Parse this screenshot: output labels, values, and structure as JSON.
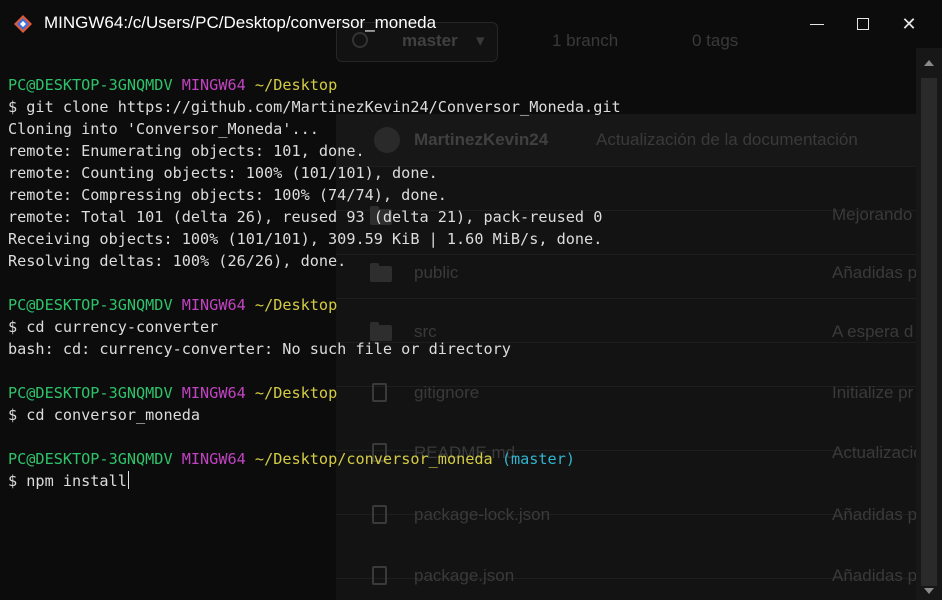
{
  "window": {
    "title": "MINGW64:/c/Users/PC/Desktop/conversor_moneda",
    "app_icon": "git-bash-icon",
    "controls": {
      "minimize": "minimize-icon",
      "maximize": "maximize-icon",
      "close": "close-icon",
      "close_glyph": "✕"
    }
  },
  "background": {
    "branch_button": "master",
    "branch_count": "1 branch",
    "tag_count": "0 tags",
    "commit_author": "MartinezKevin24",
    "commit_message": "Actualización de la documentación",
    "files": [
      {
        "name": "",
        "message": "Mejorando",
        "type": "folder"
      },
      {
        "name": "public",
        "message": "Añadidas p",
        "type": "folder"
      },
      {
        "name": "src",
        "message": "A espera d",
        "type": "folder"
      },
      {
        "name": "gitignore",
        "message": "Initialize pr",
        "type": "file"
      },
      {
        "name": "README.md",
        "message": "Actualizacio",
        "type": "file"
      },
      {
        "name": "package-lock.json",
        "message": "Añadidas p",
        "type": "file"
      },
      {
        "name": "package.json",
        "message": "Añadidas p",
        "type": "file"
      }
    ]
  },
  "terminal": {
    "prompts": [
      {
        "user": "PC@DESKTOP-3GNQMDV",
        "shell": "MINGW64",
        "path": "~/Desktop",
        "branch": "",
        "command": "$ git clone https://github.com/MartinezKevin24/Conversor_Moneda.git"
      },
      {
        "user": "PC@DESKTOP-3GNQMDV",
        "shell": "MINGW64",
        "path": "~/Desktop",
        "branch": "",
        "command": "$ cd currency-converter"
      },
      {
        "user": "PC@DESKTOP-3GNQMDV",
        "shell": "MINGW64",
        "path": "~/Desktop",
        "branch": "",
        "command": "$ cd conversor_moneda"
      },
      {
        "user": "PC@DESKTOP-3GNQMDV",
        "shell": "MINGW64",
        "path": "~/Desktop/conversor_moneda",
        "branch": "(master)",
        "command": "$ npm install"
      }
    ],
    "output_clone": [
      "Cloning into 'Conversor_Moneda'...",
      "remote: Enumerating objects: 101, done.",
      "remote: Counting objects: 100% (101/101), done.",
      "remote: Compressing objects: 100% (74/74), done.",
      "remote: Total 101 (delta 26), reused 93 (delta 21), pack-reused 0",
      "Receiving objects: 100% (101/101), 309.59 KiB | 1.60 MiB/s, done.",
      "Resolving deltas: 100% (26/26), done."
    ],
    "output_cd_error": "bash: cd: currency-converter: No such file or directory"
  },
  "colors": {
    "background": "#0c0c0c",
    "prompt_user": "#2ec36a",
    "prompt_host": "#c243c2",
    "prompt_path": "#d4cc44",
    "prompt_branch": "#31b4cf",
    "text": "#dcdcdc"
  }
}
